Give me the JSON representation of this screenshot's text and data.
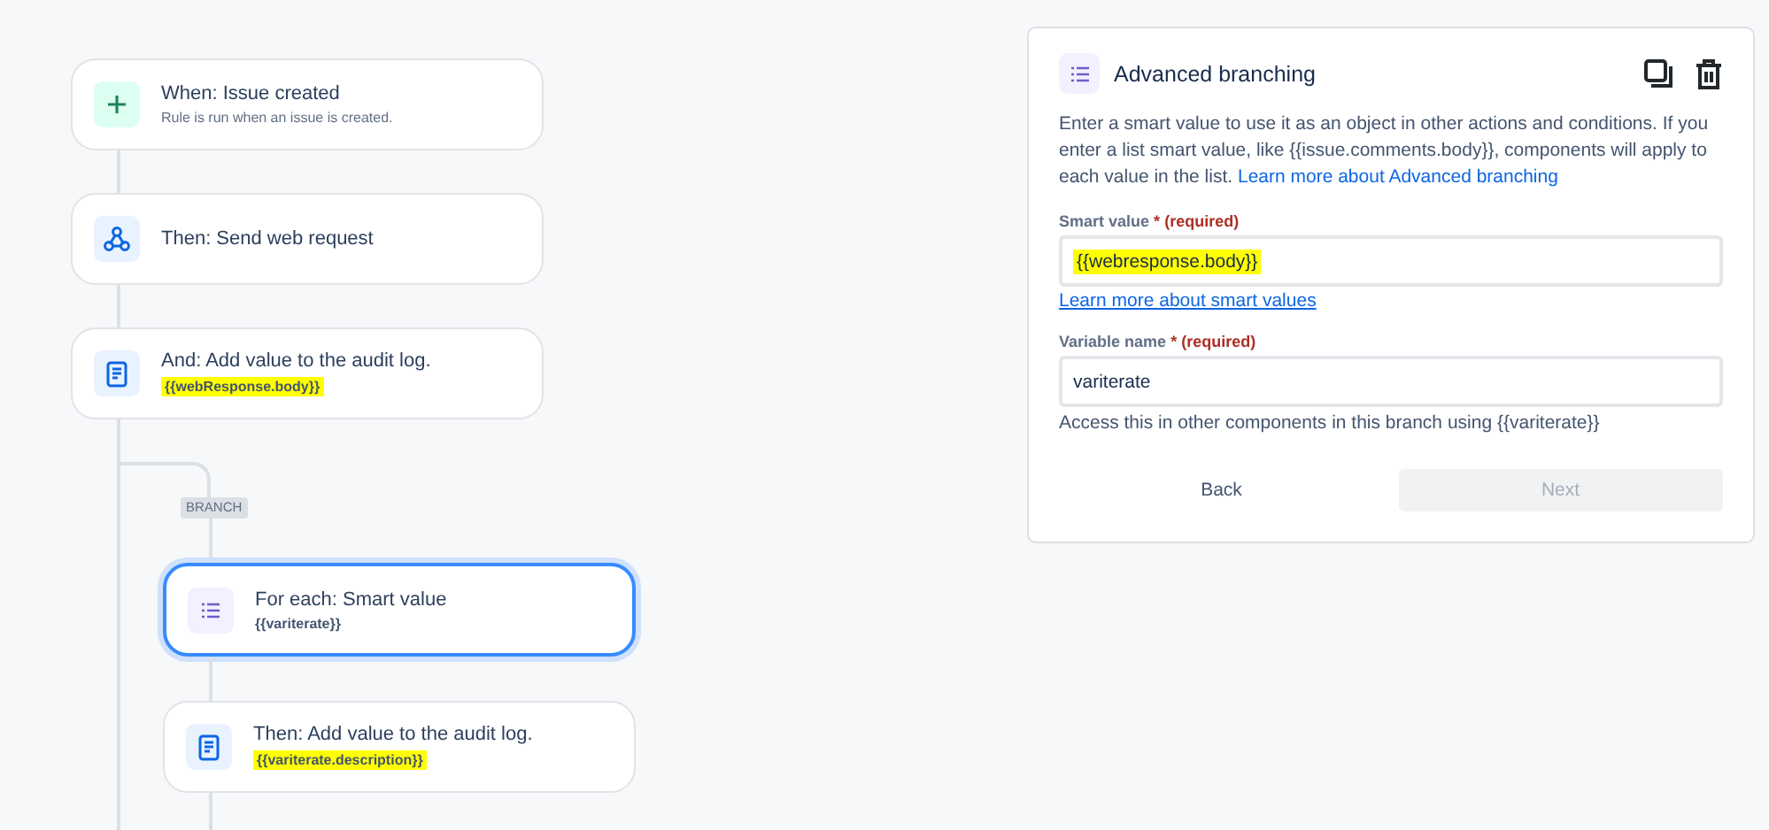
{
  "flow": [
    {
      "kind": "trigger",
      "title": "When: Issue created",
      "subtitle": "Rule is run when an issue is created.",
      "highlighted": false,
      "selected": false
    },
    {
      "kind": "webhook",
      "title": "Then: Send web request",
      "selected": false
    },
    {
      "kind": "log",
      "title": "And: Add value to the audit log.",
      "subtitle": "{{webResponse.body}}",
      "highlighted": true,
      "selected": false
    }
  ],
  "branch": {
    "tag": "BRANCH",
    "steps": [
      {
        "kind": "foreach",
        "title": "For each: Smart value",
        "subtitle": "{{variterate}}",
        "highlighted": false,
        "selected": true
      },
      {
        "kind": "log",
        "title": "Then: Add value to the audit log.",
        "subtitle": "{{variterate.description}}",
        "highlighted": true,
        "selected": false
      }
    ]
  },
  "panel": {
    "title": "Advanced branching",
    "description": "Enter a smart value to use it as an object in other actions and conditions. If you enter a list smart value, like {{issue.comments.body}}, components will apply to each value in the list.",
    "description_link": "Learn more about Advanced branching",
    "fields": [
      {
        "label": "Smart value",
        "asterisk": "*",
        "required": "(required)",
        "value": "{{webresponse.body}}",
        "highlighted": true,
        "link": "Learn more about smart values"
      },
      {
        "label": "Variable name",
        "asterisk": "*",
        "required": "(required)",
        "value": "variterate",
        "highlighted": false,
        "helper": "Access this in other components in this branch using {{variterate}}"
      }
    ],
    "buttons": [
      {
        "label": "Back",
        "disabled": false
      },
      {
        "label": "Next",
        "disabled": true
      }
    ]
  }
}
